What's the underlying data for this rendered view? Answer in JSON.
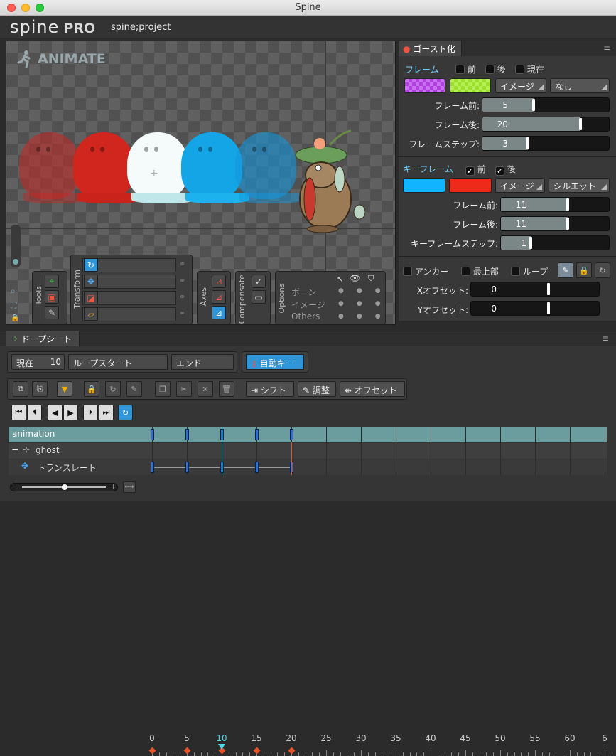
{
  "window": {
    "title": "Spine"
  },
  "app": {
    "logo": "spine",
    "edition": "PRO",
    "project": "spine;project"
  },
  "viewport": {
    "mode_label": "ANIMATE"
  },
  "tools": {
    "tools_label": "Tools",
    "transform_label": "Transform",
    "axes_label": "Axes",
    "compensate_label": "Compensate",
    "options_label": "Options",
    "options_rows": [
      "ボーン",
      "イメージ",
      "Others"
    ]
  },
  "ghost_panel": {
    "tab_title": "ゴースト化",
    "frames": {
      "heading": "フレーム",
      "before_label": "前",
      "after_label": "後",
      "current_label": "現在",
      "before_color": "#b040e0",
      "after_color": "#9adf2a",
      "mode": "イメージ",
      "blend": "なし",
      "rows": [
        {
          "label": "フレーム前:",
          "value": "5",
          "fill": 0.25
        },
        {
          "label": "フレーム後:",
          "value": "20",
          "fill": 0.72
        },
        {
          "label": "フレームステップ:",
          "value": "3",
          "fill": 0.2
        }
      ]
    },
    "keyframes": {
      "heading": "キーフレーム",
      "before_label": "前",
      "after_label": "後",
      "before_color": "#10b4ff",
      "after_color": "#ee2a1a",
      "mode": "イメージ",
      "blend": "シルエット",
      "rows": [
        {
          "label": "フレーム前:",
          "value": "11",
          "fill": 0.5
        },
        {
          "label": "フレーム後:",
          "value": "11",
          "fill": 0.5
        },
        {
          "label": "キーフレームステップ:",
          "value": "1",
          "fill": 0.05
        }
      ]
    },
    "options": {
      "anchor_label": "アンカー",
      "top_label": "最上部",
      "loop_label": "ループ",
      "x_offset_label": "Xオフセット:",
      "x_offset_value": "0",
      "y_offset_label": "Yオフセット:",
      "y_offset_value": "0"
    }
  },
  "dopesheet": {
    "tab_title": "ドープシート",
    "current_label": "現在",
    "current_value": "10",
    "loop_start_label": "ループスタート",
    "end_label": "エンド",
    "autokey_label": "自動キー",
    "shift_label": "シフト",
    "adjust_label": "調整",
    "offset_label": "オフセット",
    "ruler_numbers": [
      "0",
      "5",
      "10",
      "15",
      "20",
      "25",
      "30",
      "35",
      "40",
      "45",
      "50",
      "55",
      "60",
      "6"
    ],
    "current_frame": 10,
    "rows": [
      {
        "label": "animation",
        "kind": "animation"
      },
      {
        "label": "ghost",
        "kind": "bone"
      },
      {
        "label": "トランスレート",
        "kind": "timeline"
      }
    ],
    "keyframes": [
      0,
      5,
      10,
      15,
      20
    ],
    "accent_color": "#2f95d6"
  }
}
